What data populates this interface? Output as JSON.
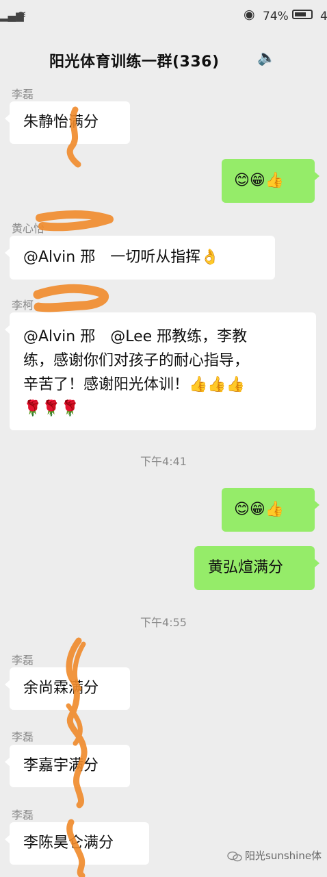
{
  "status": {
    "battery": "74%",
    "battery_fraction": 0.74,
    "extra": "4"
  },
  "header": {
    "title": "阳光体育训练一群(336)"
  },
  "messages": [
    {
      "sender": "李磊",
      "text": "朱静怡满分"
    },
    {
      "text": "😊😁👍"
    },
    {
      "sender": "黄心怡",
      "text": "@Alvin 邢　一切听从指挥👌"
    },
    {
      "sender": "李柯",
      "line1": "@Alvin 邢　@Lee 邢教练，李教",
      "line2": "练，感谢你们对孩子的耐心指导，",
      "line3": "辛苦了！感谢阳光体训！👍👍👍",
      "line4": "🌹🌹🌹"
    },
    {
      "time": "下午4:41"
    },
    {
      "text": "😊😁👍"
    },
    {
      "text": "黄弘煊满分"
    },
    {
      "time": "下午4:55"
    },
    {
      "sender": "李磊",
      "text": "余尚霖满分"
    },
    {
      "sender": "李磊",
      "text": "李嘉宇满分"
    },
    {
      "sender": "李磊",
      "text": "李陈昊仑满分"
    }
  ],
  "watermark": "阳光sunshine体"
}
